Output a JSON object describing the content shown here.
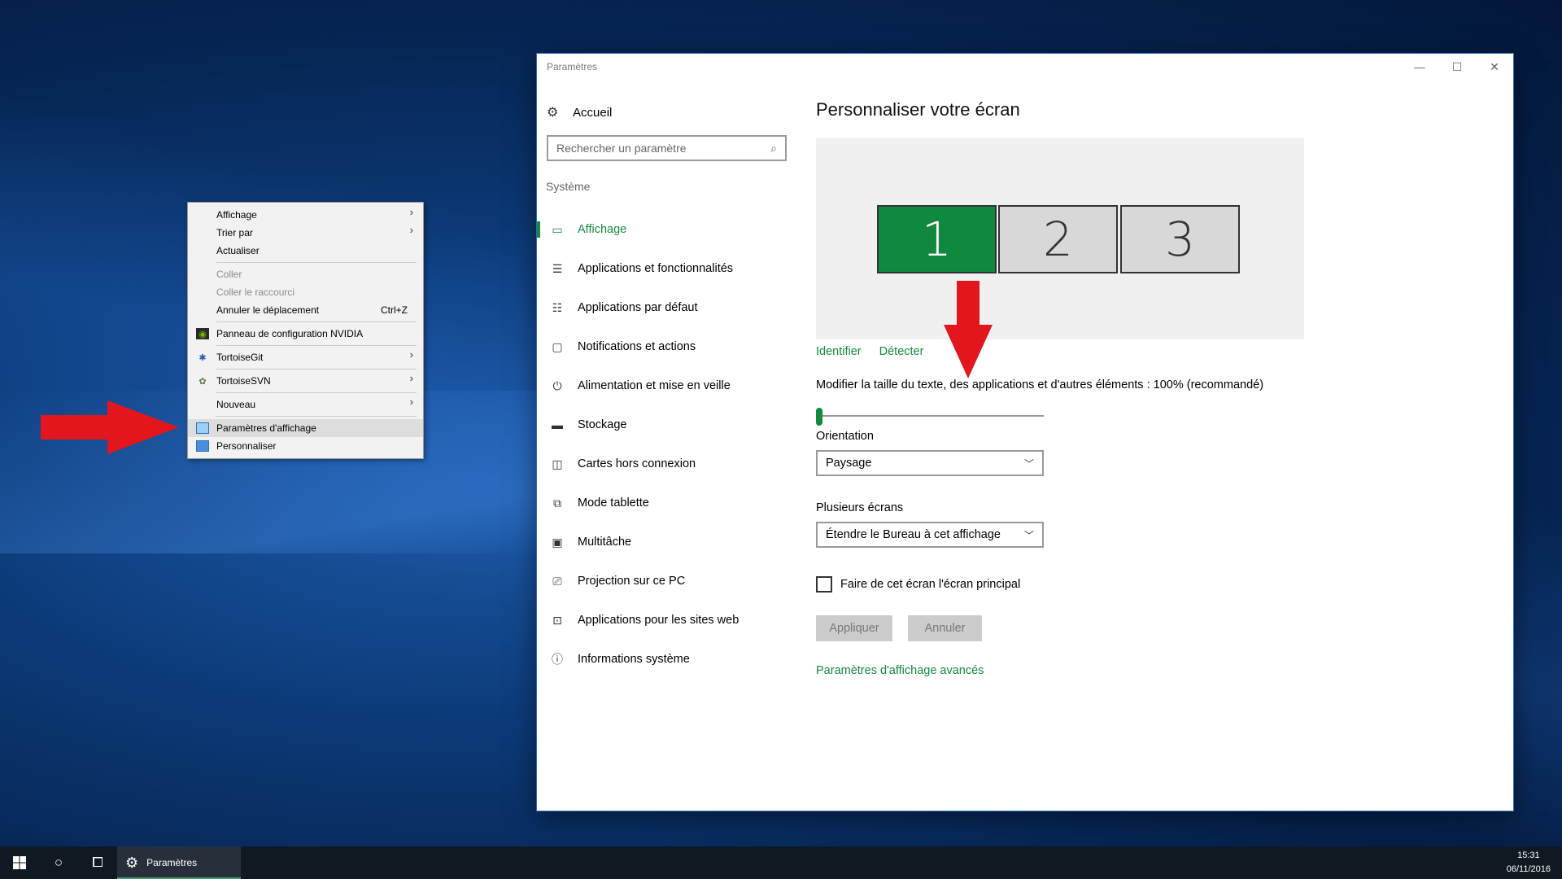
{
  "window": {
    "title": "Paramètres",
    "controls": {
      "minimize": "—",
      "maximize": "☐",
      "close": "✕"
    }
  },
  "sidebar": {
    "home_label": "Accueil",
    "search_placeholder": "Rechercher un paramètre",
    "section": "Système",
    "items": [
      {
        "label": "Affichage",
        "icon": "display-icon",
        "active": true
      },
      {
        "label": "Applications et fonctionnalités",
        "icon": "apps-list-icon"
      },
      {
        "label": "Applications par défaut",
        "icon": "default-apps-icon"
      },
      {
        "label": "Notifications et actions",
        "icon": "notifications-icon"
      },
      {
        "label": "Alimentation et mise en veille",
        "icon": "power-icon"
      },
      {
        "label": "Stockage",
        "icon": "storage-icon"
      },
      {
        "label": "Cartes hors connexion",
        "icon": "map-icon"
      },
      {
        "label": "Mode tablette",
        "icon": "tablet-icon"
      },
      {
        "label": "Multitâche",
        "icon": "multitask-icon"
      },
      {
        "label": "Projection sur ce PC",
        "icon": "projection-icon"
      },
      {
        "label": "Applications pour les sites web",
        "icon": "web-apps-icon"
      },
      {
        "label": "Informations système",
        "icon": "info-icon"
      }
    ]
  },
  "content": {
    "title": "Personnaliser votre écran",
    "monitors": [
      "1",
      "2",
      "3"
    ],
    "active_monitor": "1",
    "identify_link": "Identifier",
    "detect_link": "Détecter",
    "scale_label": "Modifier la taille du texte, des applications et d'autres éléments : 100% (recommandé)",
    "scale_value_fraction": 0,
    "orientation_label": "Orientation",
    "orientation_value": "Paysage",
    "multi_label": "Plusieurs écrans",
    "multi_value": "Étendre le Bureau à cet affichage",
    "main_display_label": "Faire de cet écran l'écran principal",
    "main_display_checked": false,
    "apply_button": "Appliquer",
    "cancel_button": "Annuler",
    "advanced_link": "Paramètres d'affichage avancés"
  },
  "context_menu": {
    "view": "Affichage",
    "sort_by": "Trier par",
    "refresh": "Actualiser",
    "paste": "Coller",
    "paste_shortcut": "Coller le raccourci",
    "undo_move": "Annuler le déplacement",
    "undo_shortcut": "Ctrl+Z",
    "nvidia": "Panneau de configuration NVIDIA",
    "tortoisegit": "TortoiseGit",
    "tortoisesvn": "TortoiseSVN",
    "new": "Nouveau",
    "display_settings": "Paramètres d'affichage",
    "personalize": "Personnaliser"
  },
  "taskbar": {
    "app_label": "Paramètres",
    "time": "15:31",
    "date": "06/11/2016"
  },
  "colors": {
    "accent": "#138a3f",
    "active_monitor": "#10893e",
    "annotation_arrow": "#e3151d"
  }
}
